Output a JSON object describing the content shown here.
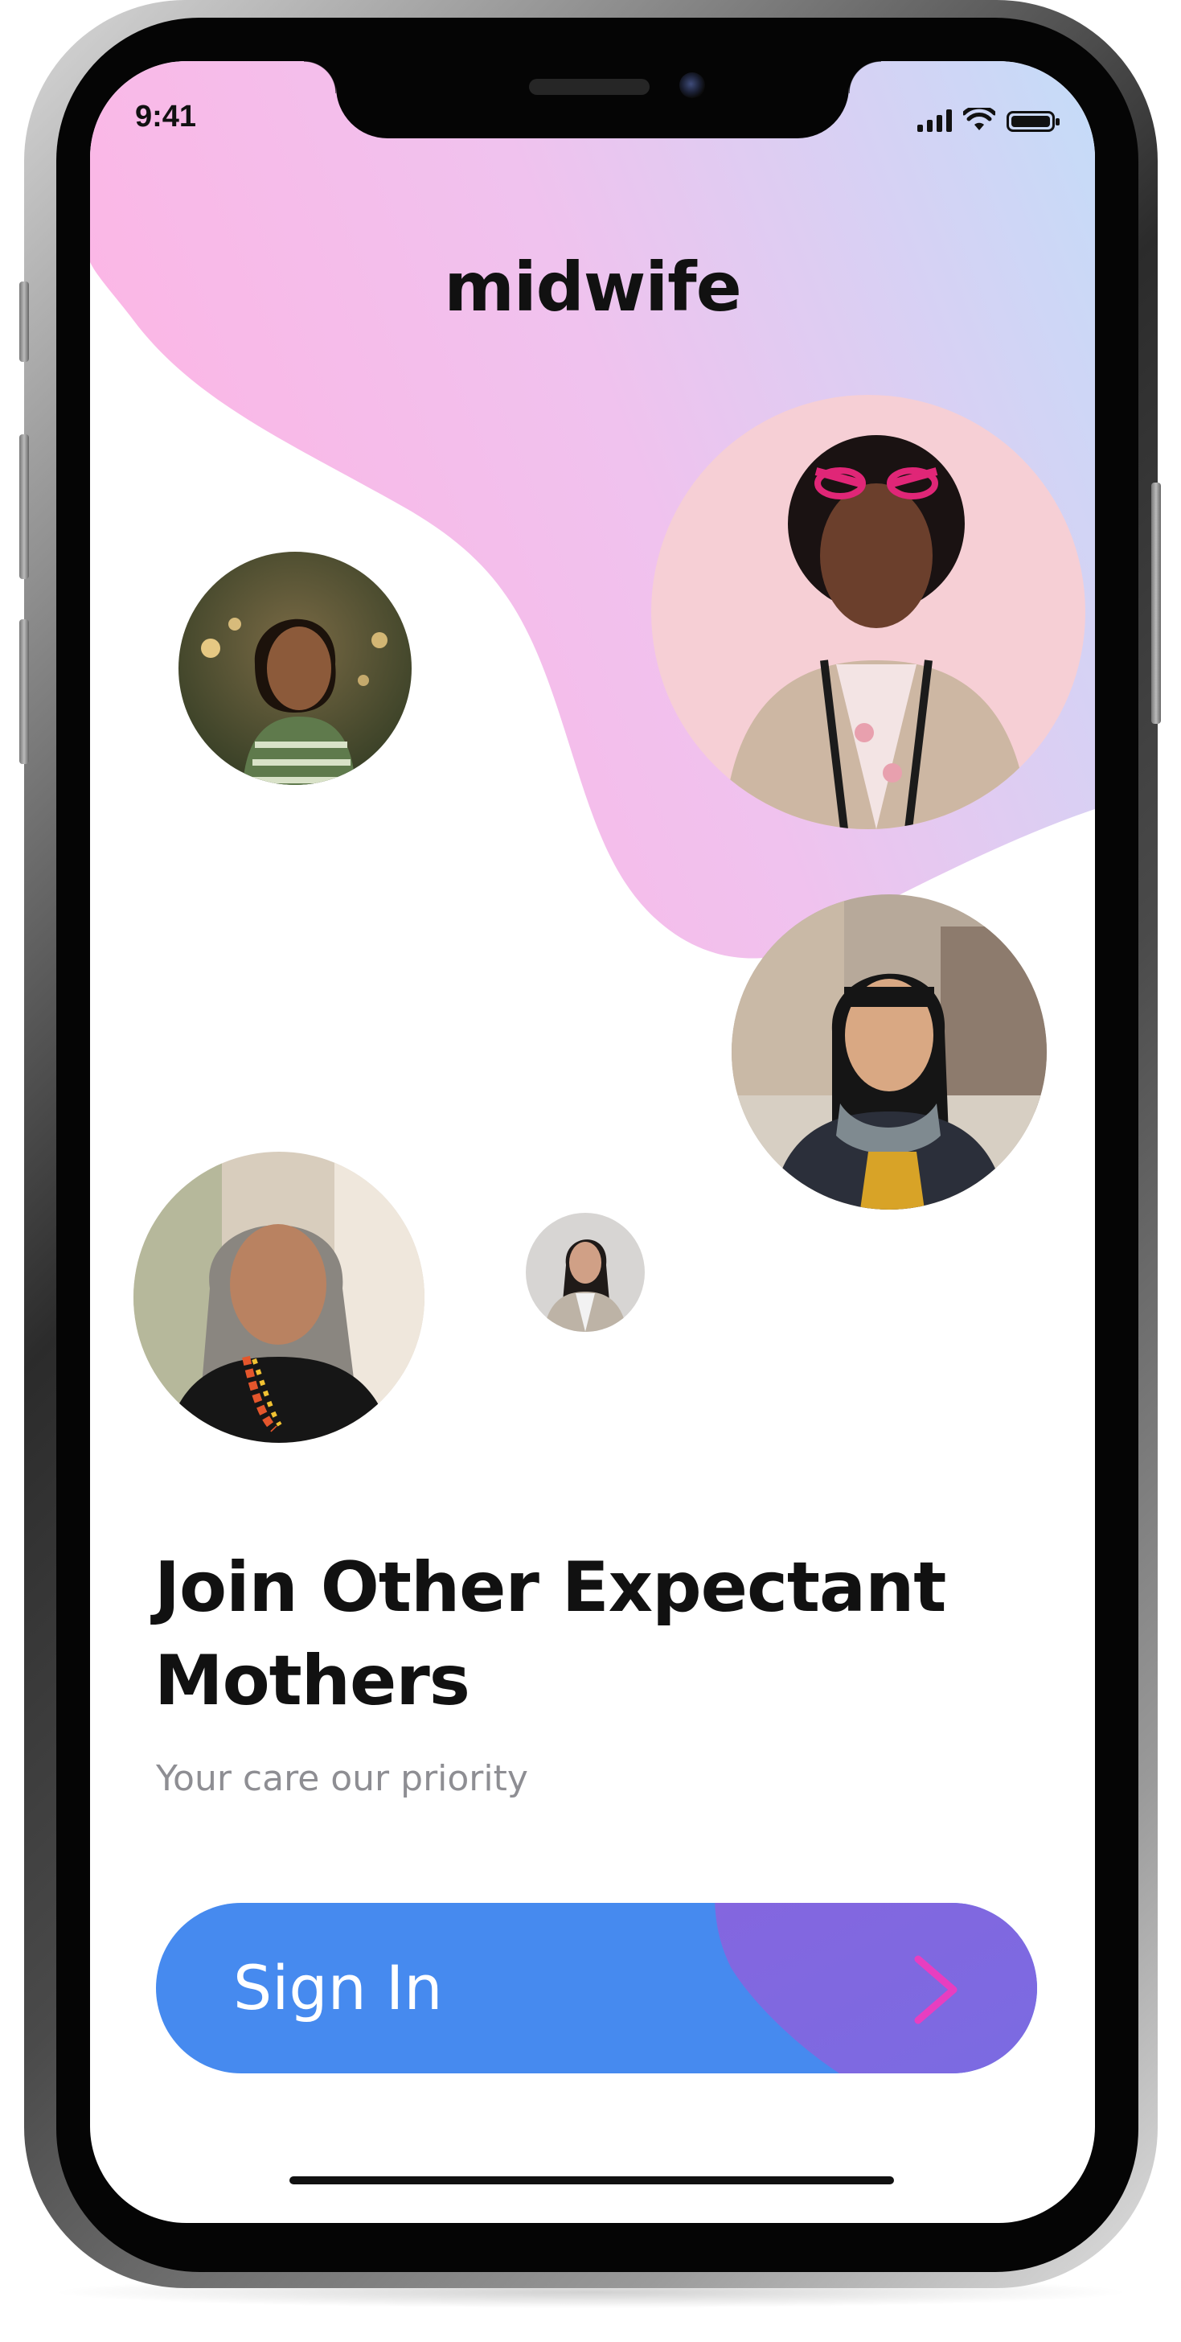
{
  "status_bar": {
    "time": "9:41",
    "icons": [
      "signal-icon",
      "wifi-icon",
      "battery-icon"
    ]
  },
  "app": {
    "logo": "midwife"
  },
  "colors": {
    "blob_pink": "#f9b8e6",
    "blob_blue": "#c6dcf8",
    "button_blue": "#468aef",
    "button_purple": "#7b6ee0",
    "arrow_pink": "#e83ec0"
  },
  "avatars": [
    {
      "name": "woman-bokeh-lights",
      "icon": "person-avatar"
    },
    {
      "name": "woman-pink-glasses",
      "icon": "person-avatar"
    },
    {
      "name": "woman-street-scarf",
      "icon": "person-avatar"
    },
    {
      "name": "older-woman-necklace",
      "icon": "person-avatar"
    },
    {
      "name": "woman-small-gray",
      "icon": "person-avatar"
    }
  ],
  "onboarding": {
    "headline_line1": "Join Other Expectant",
    "headline_line2": "Mothers",
    "subtitle": "Your care our priority"
  },
  "signin": {
    "label": "Sign In",
    "icon": "arrow-right-icon"
  }
}
